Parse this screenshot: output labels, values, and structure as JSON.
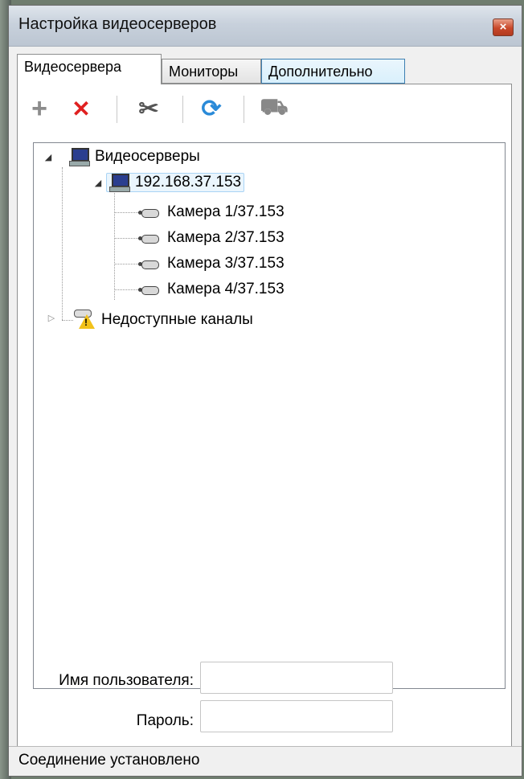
{
  "window": {
    "title": "Настройка видеосерверов",
    "close_symbol": "×"
  },
  "tabs": [
    {
      "label": "Видеосервера",
      "active": true
    },
    {
      "label": "Мониторы",
      "active": false
    },
    {
      "label": "Дополнительно",
      "active": false
    }
  ],
  "toolbar": {
    "buttons": [
      {
        "icon": "plus-icon",
        "glyph": "+"
      },
      {
        "icon": "delete-icon",
        "glyph": "✕"
      },
      {
        "icon": "settings-tools-icon",
        "glyph": "✂"
      },
      {
        "icon": "refresh-icon",
        "glyph": "⟳"
      },
      {
        "icon": "camera-gray-icon",
        "glyph": "⛟"
      }
    ]
  },
  "tree": {
    "root": {
      "label": "Видеосерверы"
    },
    "server": {
      "label": "192.168.37.153"
    },
    "cameras": [
      {
        "label": "Камера 1/37.153"
      },
      {
        "label": "Камера 2/37.153"
      },
      {
        "label": "Камера 3/37.153"
      },
      {
        "label": "Камера 4/37.153"
      }
    ],
    "unavailable": {
      "label": "Недоступные каналы"
    }
  },
  "form": {
    "username_label": "Имя пользователя:",
    "username_value": "",
    "password_label": "Пароль:",
    "password_value": ""
  },
  "status": {
    "text": "Соединение установлено"
  },
  "colors": {
    "accent_selection": "#a9d4f5",
    "delete_red": "#e02020",
    "add_gray": "#8c8c8c",
    "refresh_blue": "#2a8ad8"
  }
}
